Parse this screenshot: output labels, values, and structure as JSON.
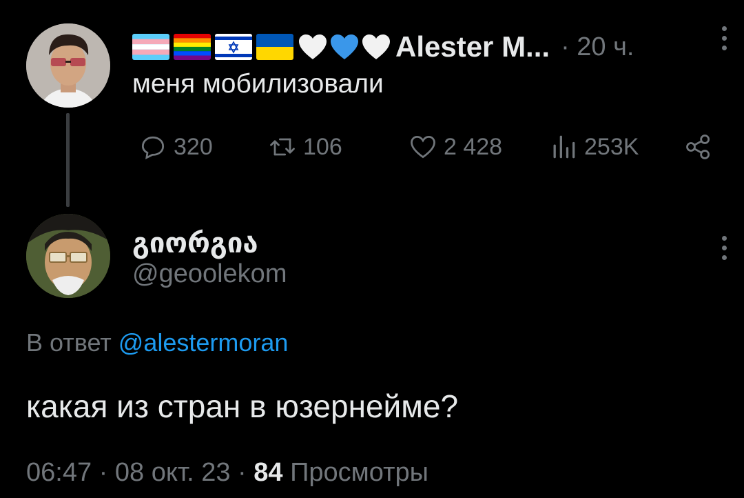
{
  "tweet1": {
    "author_name": "Alester M...",
    "time": "· 20 ч.",
    "text": "меня мобилизовали",
    "flags": [
      "transgender-flag",
      "rainbow-pride-flag",
      "israel-flag",
      "ukraine-flag"
    ],
    "hearts": [
      "white-heart",
      "blue-heart",
      "white-heart"
    ],
    "stats": {
      "replies": "320",
      "retweets": "106",
      "likes": "2 428",
      "views": "253K"
    }
  },
  "tweet2": {
    "author_name": "გიორგია",
    "handle": "@geoolekom",
    "reply_prefix": "В ответ ",
    "reply_mention": "@alestermoran",
    "text": "какая из стран в юзернейме?",
    "time": "06:47",
    "date": "08 окт. 23",
    "views_count": "84",
    "views_label": "Просмотры"
  },
  "colors": {
    "background": "#000000",
    "text_primary": "#e7e9ea",
    "text_secondary": "#71767b",
    "accent": "#1d9bf0"
  }
}
